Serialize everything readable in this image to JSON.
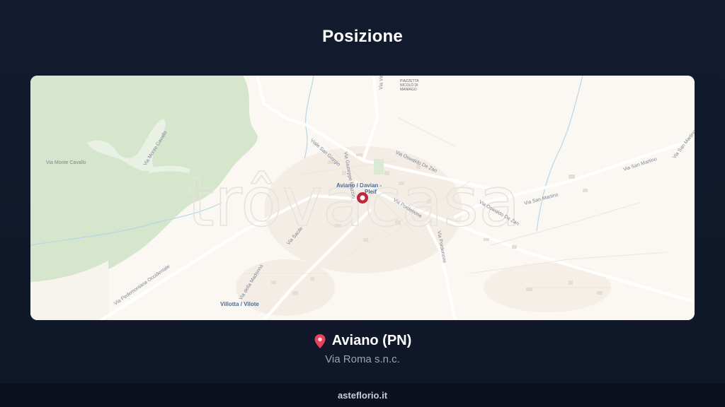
{
  "page": {
    "title": "Posizione"
  },
  "map": {
    "watermark": "trôvacasa",
    "streets": [
      "Via Monte Cavallo",
      "Via Monte Cavallo",
      "Viale San Giorgio",
      "Via Giuseppe Mazzini",
      "Via Oswaldo De Zan",
      "Via Pordenone",
      "Via Pordenone",
      "Via Oswaldo De Zan",
      "Via San Martino",
      "Via San Martino",
      "Via San Martino",
      "Via Sacile",
      "Via della Madonna",
      "Via Pedemontana Occidentale",
      "Via Vittorio"
    ],
    "places": {
      "center_line1": "Aviano / Davian -",
      "center_line2": "Pleif",
      "villotta": "Villotta / Vilote",
      "piazzetta_l1": "PIAZZETTA",
      "piazzetta_l2": "NICOLÒ DI",
      "piazzetta_l3": "MANIAGO"
    },
    "colors": {
      "background": "#fbf8f3",
      "park": "#d7e8cf",
      "road": "#ffffff",
      "water": "#a9cde0",
      "pin": "#c0283a"
    }
  },
  "location": {
    "icon": "map-pin-icon",
    "name": "Aviano (PN)",
    "address": "Via Roma s.n.c."
  },
  "footer": {
    "site": "asteflorio.it"
  }
}
